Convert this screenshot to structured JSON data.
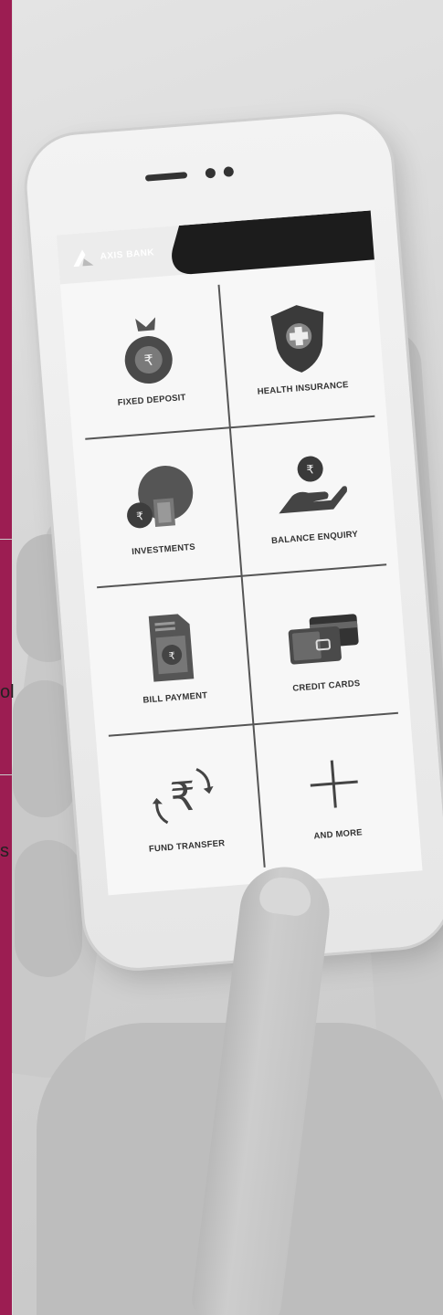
{
  "sidebar": {
    "fragment_1": "ol",
    "fragment_2": "s"
  },
  "app": {
    "brand": "AXIS BANK",
    "brand_color": "#9c1d52"
  },
  "tiles": [
    {
      "label": "FIXED DEPOSIT",
      "icon": "money-bag-icon"
    },
    {
      "label": "HEALTH INSURANCE",
      "icon": "shield-plus-icon"
    },
    {
      "label": "INVESTMENTS",
      "icon": "pie-chart-icon"
    },
    {
      "label": "BALANCE ENQUIRY",
      "icon": "hand-coin-icon"
    },
    {
      "label": "BILL PAYMENT",
      "icon": "bill-document-icon"
    },
    {
      "label": "CREDIT CARDS",
      "icon": "credit-card-icon"
    },
    {
      "label": "FUND TRANSFER",
      "icon": "rupee-transfer-icon"
    },
    {
      "label": "AND MORE",
      "icon": "plus-icon"
    }
  ]
}
